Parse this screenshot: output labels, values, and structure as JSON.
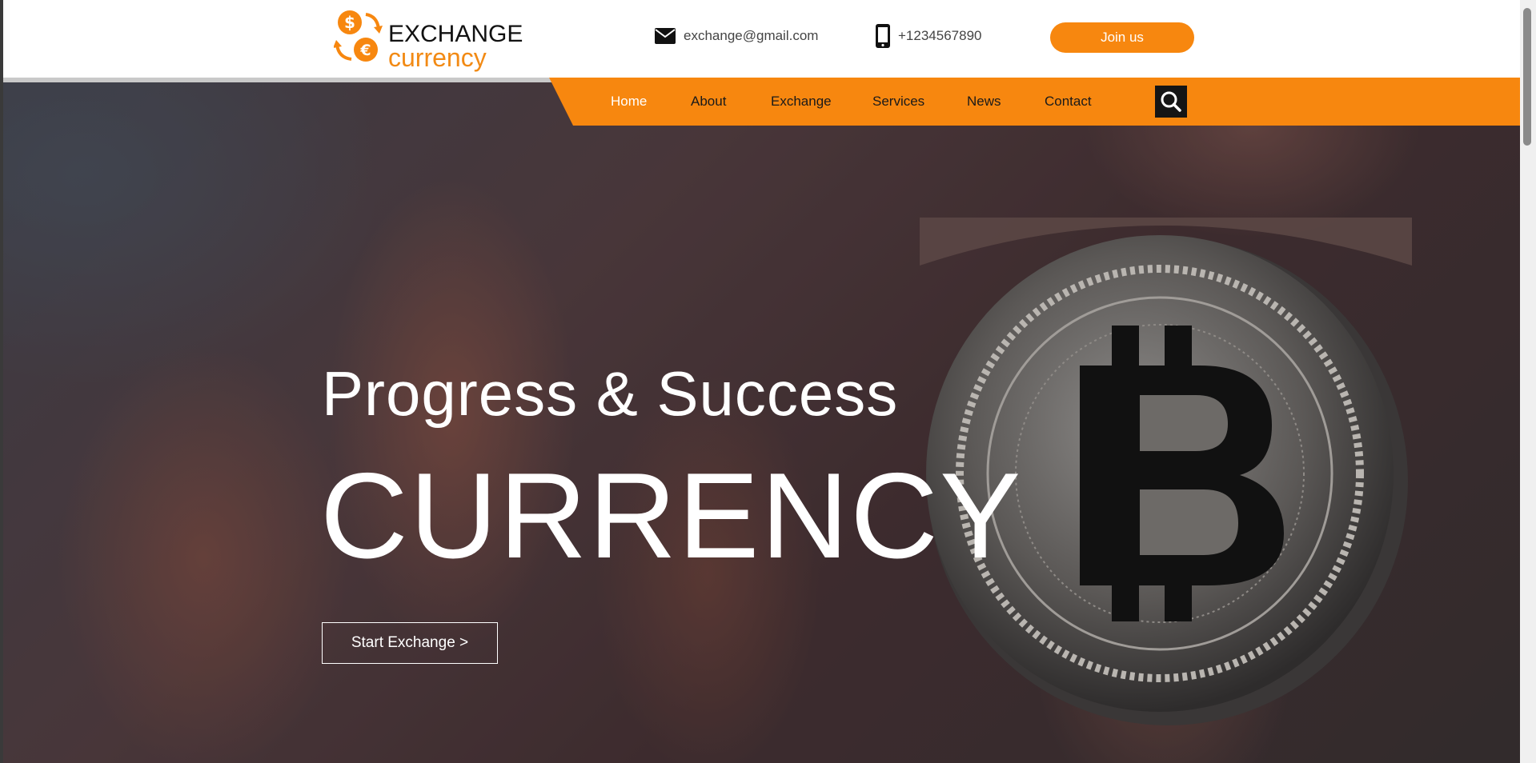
{
  "brand": {
    "name_line1": "EXCHANGE",
    "name_line2": "currency",
    "accent_color": "#f7870f"
  },
  "contacts": {
    "email": "exchange@gmail.com",
    "email_icon": "envelope-icon",
    "phone": "+1234567890",
    "phone_icon": "smartphone-icon"
  },
  "header": {
    "join_label": "Join us"
  },
  "nav": {
    "items": [
      {
        "label": "Home",
        "active": true
      },
      {
        "label": "About"
      },
      {
        "label": "Exchange"
      },
      {
        "label": "Services"
      },
      {
        "label": "News"
      },
      {
        "label": "Contact"
      }
    ],
    "search_icon": "search-icon"
  },
  "hero": {
    "subtitle": "Progress & Success",
    "title": "CURRENCY",
    "cta_label": "Start Exchange >",
    "background": "hand holding bitcoin coin"
  }
}
